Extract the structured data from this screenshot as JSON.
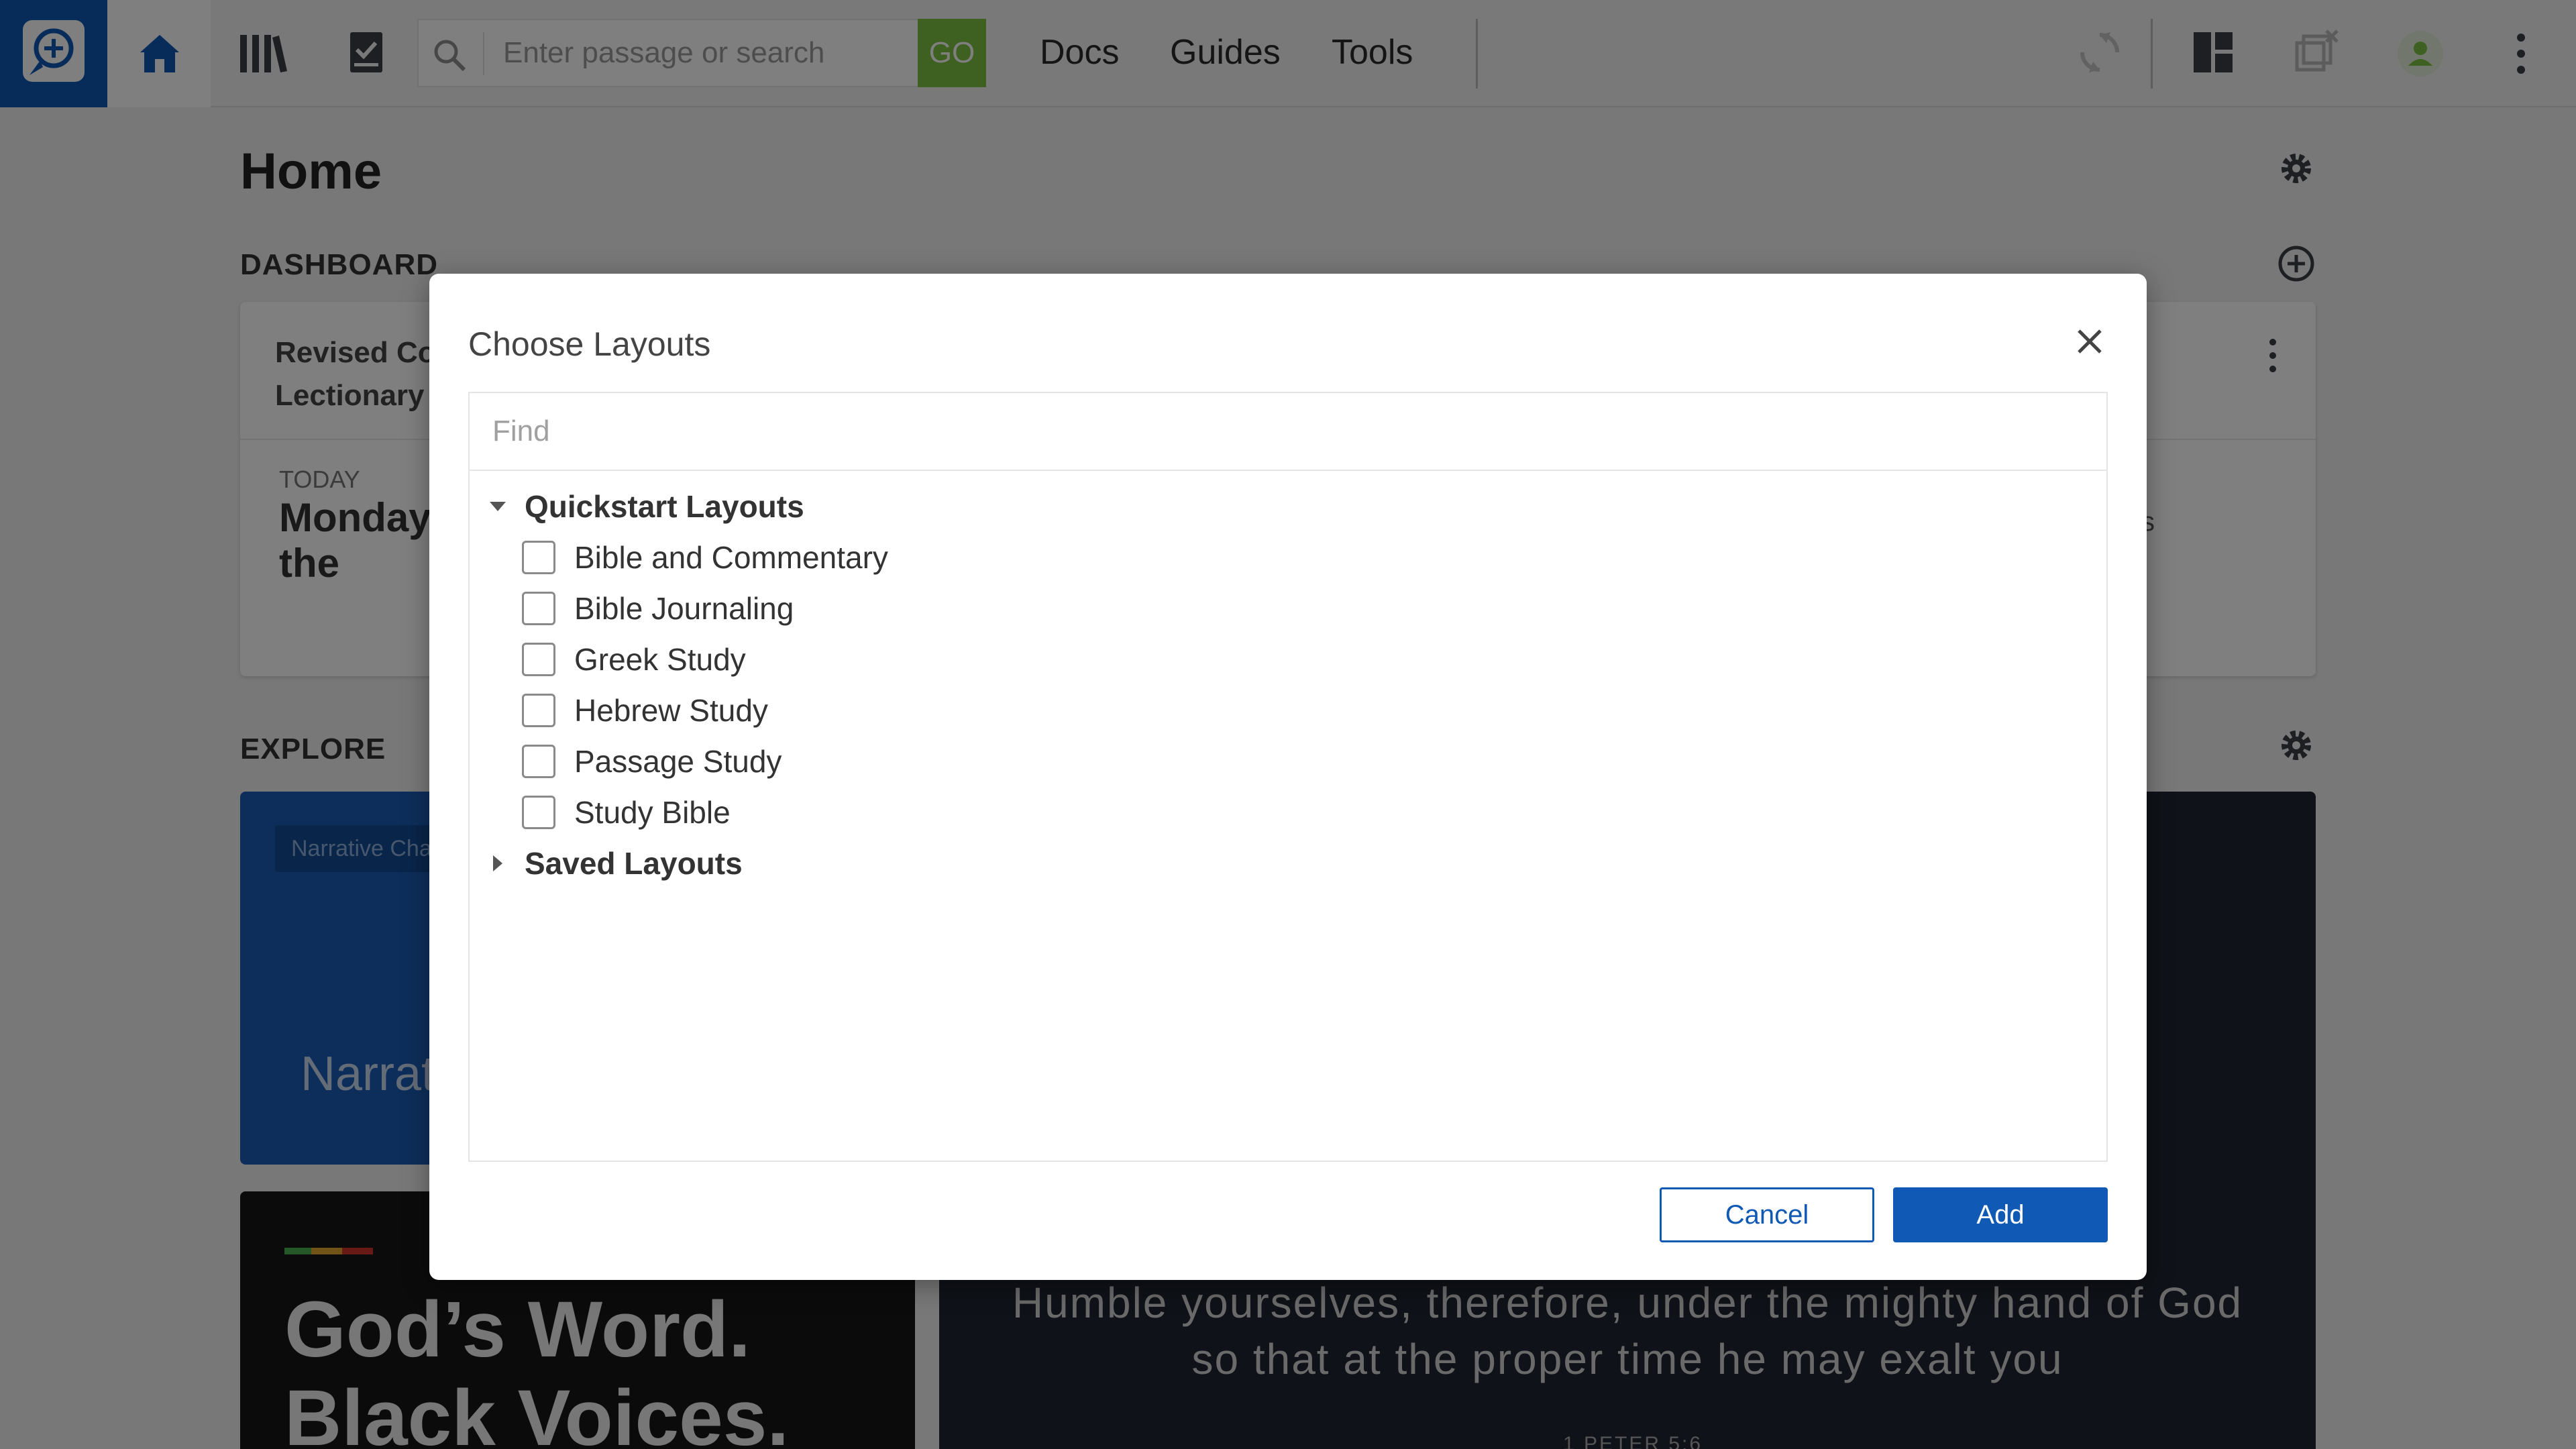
{
  "topbar": {
    "search_placeholder": "Enter passage or search",
    "go_label": "GO",
    "nav": [
      "Docs",
      "Guides",
      "Tools"
    ]
  },
  "page": {
    "title": "Home",
    "dashboard_heading": "DASHBOARD",
    "explore_heading": "EXPLORE",
    "readings_card": {
      "title": "Revised Common Lectionary Readings",
      "today_label": "TODAY",
      "day_text": "Monday after the",
      "side_fragment": "s"
    },
    "narrative_card": {
      "pill": "Narrative Cha",
      "big": "Narrat"
    },
    "banner_card": {
      "line1": "God’s Word.",
      "line2": "Black Voices."
    },
    "verse_card": {
      "line1": "Humble yourselves, therefore, under the mighty hand of God",
      "line2": "so that at the proper time he may exalt you",
      "reference": "1 PETER 5:6"
    }
  },
  "modal": {
    "title": "Choose Layouts",
    "find_placeholder": "Find",
    "groups": [
      {
        "label": "Quickstart Layouts",
        "expanded": true,
        "items": [
          "Bible and Commentary",
          "Bible Journaling",
          "Greek Study",
          "Hebrew Study",
          "Passage Study",
          "Study Bible"
        ]
      },
      {
        "label": "Saved Layouts",
        "expanded": false,
        "items": []
      }
    ],
    "cancel_label": "Cancel",
    "add_label": "Add"
  },
  "colors": {
    "brand_blue": "#1059b5",
    "go_green": "#7cc243",
    "avatar_green": "#7cc243"
  }
}
